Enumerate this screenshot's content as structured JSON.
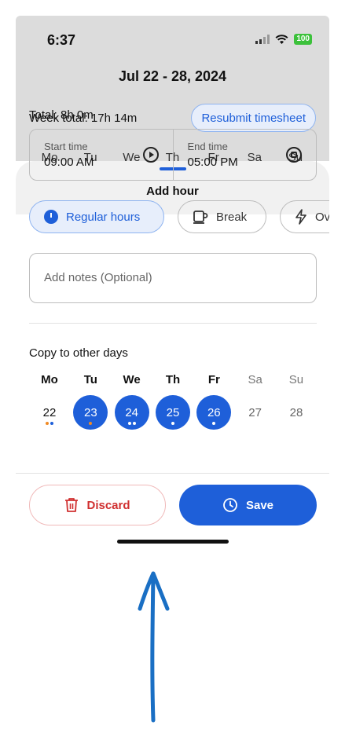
{
  "status_bar": {
    "time": "6:37",
    "battery": "100"
  },
  "header": {
    "date_range": "Jul 22 - 28, 2024",
    "week_total": "Week total: 17h 14m",
    "resubmit_label": "Resubmit timesheet",
    "days": [
      "Mo",
      "Tu",
      "We",
      "Th",
      "Fr",
      "Sa",
      "Su"
    ]
  },
  "sheet": {
    "title": "Add hour",
    "total": "Total: 8h 0m",
    "start_label": "Start time",
    "start_value": "09:00 AM",
    "end_label": "End time",
    "end_value": "05:00 PM",
    "chips": [
      "Regular hours",
      "Break",
      "Overtime"
    ],
    "notes_placeholder": "Add notes (Optional)",
    "copy_title": "Copy to other days",
    "copy_days": [
      {
        "name": "Mo",
        "num": "22",
        "selected": false
      },
      {
        "name": "Tu",
        "num": "23",
        "selected": true
      },
      {
        "name": "We",
        "num": "24",
        "selected": true
      },
      {
        "name": "Th",
        "num": "25",
        "selected": true
      },
      {
        "name": "Fr",
        "num": "26",
        "selected": true
      },
      {
        "name": "Sa",
        "num": "27",
        "selected": false
      },
      {
        "name": "Su",
        "num": "28",
        "selected": false
      }
    ],
    "discard_label": "Discard",
    "save_label": "Save"
  },
  "colors": {
    "accent": "#1e5fd9",
    "danger": "#d03030",
    "orange_dot": "#f08a24",
    "annotation_arrow": "#1a6fc4"
  }
}
